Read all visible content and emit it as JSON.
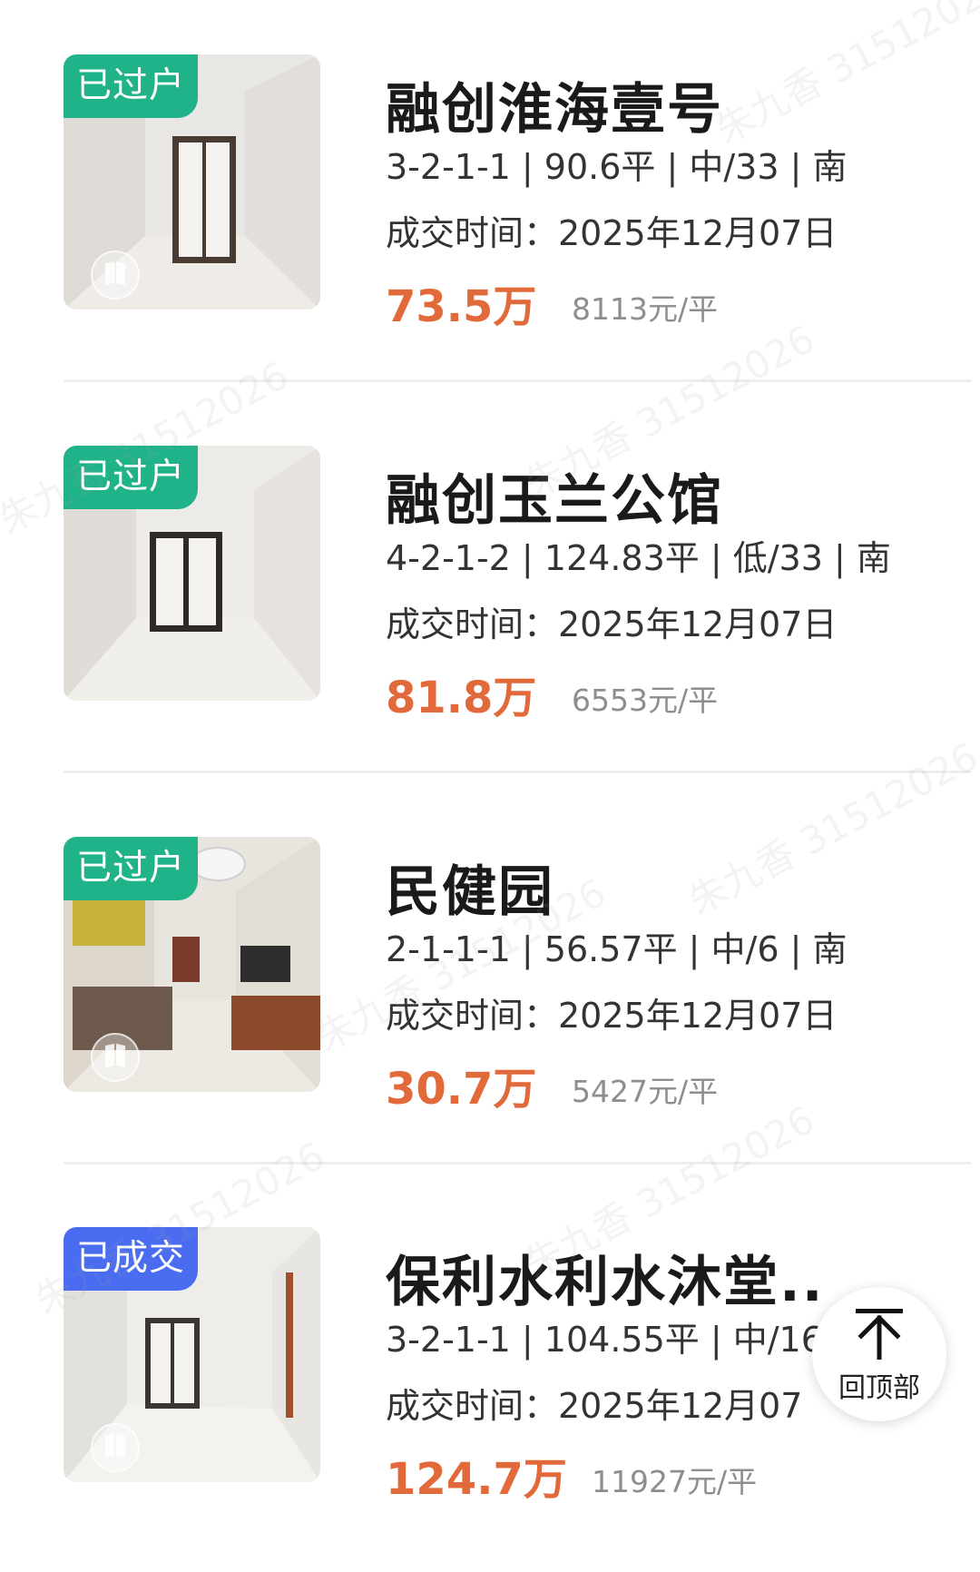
{
  "listings": [
    {
      "badge": "已过户",
      "badge_color": "#20b38a",
      "title": "融创淮海壹号",
      "specs": "3-2-1-1 | 90.6平 | 中/33 | 南",
      "deal_time": "成交时间：2025年12月07日",
      "price": "73.5万",
      "unit_price": "8113元/平"
    },
    {
      "badge": "已过户",
      "badge_color": "#20b38a",
      "title": "融创玉兰公馆",
      "specs": "4-2-1-2 | 124.83平 | 低/33 | 南",
      "deal_time": "成交时间：2025年12月07日",
      "price": "81.8万",
      "unit_price": "6553元/平"
    },
    {
      "badge": "已过户",
      "badge_color": "#20b38a",
      "title": "民健园",
      "specs": "2-1-1-1 | 56.57平 | 中/6 | 南",
      "deal_time": "成交时间：2025年12月07日",
      "price": "30.7万",
      "unit_price": "5427元/平"
    },
    {
      "badge": "已成交",
      "badge_color": "#4a6cf0",
      "title": "保利水利水沐堂..",
      "specs": "3-2-1-1 | 104.55平 | 中/16",
      "deal_time": "成交时间：2025年12月07",
      "price": "124.7万",
      "unit_price": "11927元/平"
    }
  ],
  "back_to_top": {
    "icon": "arrow-up-to-top-icon",
    "label": "回顶部"
  },
  "watermark_text": "朱九香 31512026",
  "colors": {
    "price": "#e2693a",
    "badge_transferred": "#20b38a",
    "badge_sold": "#4a6cf0"
  }
}
